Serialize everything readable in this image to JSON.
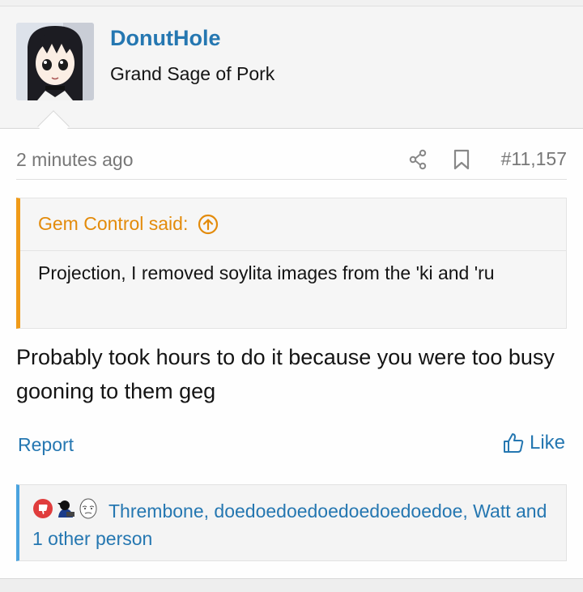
{
  "user": {
    "username": "DonutHole",
    "title": "Grand Sage of Pork",
    "avatar_icon": "anime-avatar"
  },
  "post": {
    "time": "2 minutes ago",
    "number": "#11,157",
    "share_icon": "share-icon",
    "bookmark_icon": "bookmark-icon"
  },
  "quote": {
    "author": "Gem Control said:",
    "text": "Projection, I removed soylita images from the 'ki and 'ru"
  },
  "message": {
    "text": "Probably took hours to do it because you were too busy gooning to them geg"
  },
  "actions": {
    "report": "Report",
    "like": "Like"
  },
  "reactions": {
    "users": "Thrembone, doedoedoedoedoedoedoedoe, Watt and 1 other person",
    "icons": [
      "dislike-reaction-icon",
      "hacker-reaction-icon",
      "wojak-reaction-icon"
    ]
  },
  "colors": {
    "link": "#2577b1",
    "quote_accent": "#f09b19",
    "reaction_accent": "#4aa3df"
  }
}
